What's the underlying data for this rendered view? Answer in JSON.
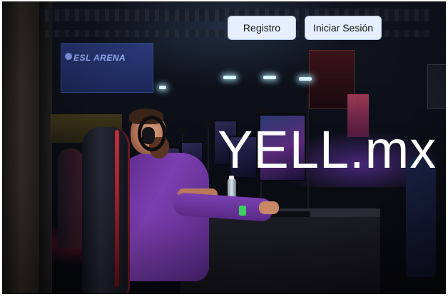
{
  "page": {
    "background_image": "esports-arena-gamer-photo"
  },
  "nav": {
    "register_label": "Registro",
    "login_label": "Iniciar Sesión"
  },
  "hero": {
    "brand_title": "YELL.mx"
  },
  "scene": {
    "banner_text": "ESL ARENA"
  },
  "colors": {
    "button_bg": "#e6efff",
    "button_border": "#b5c7ea",
    "brand_text": "#ffffff",
    "player_shirt": "#6a34a0"
  }
}
